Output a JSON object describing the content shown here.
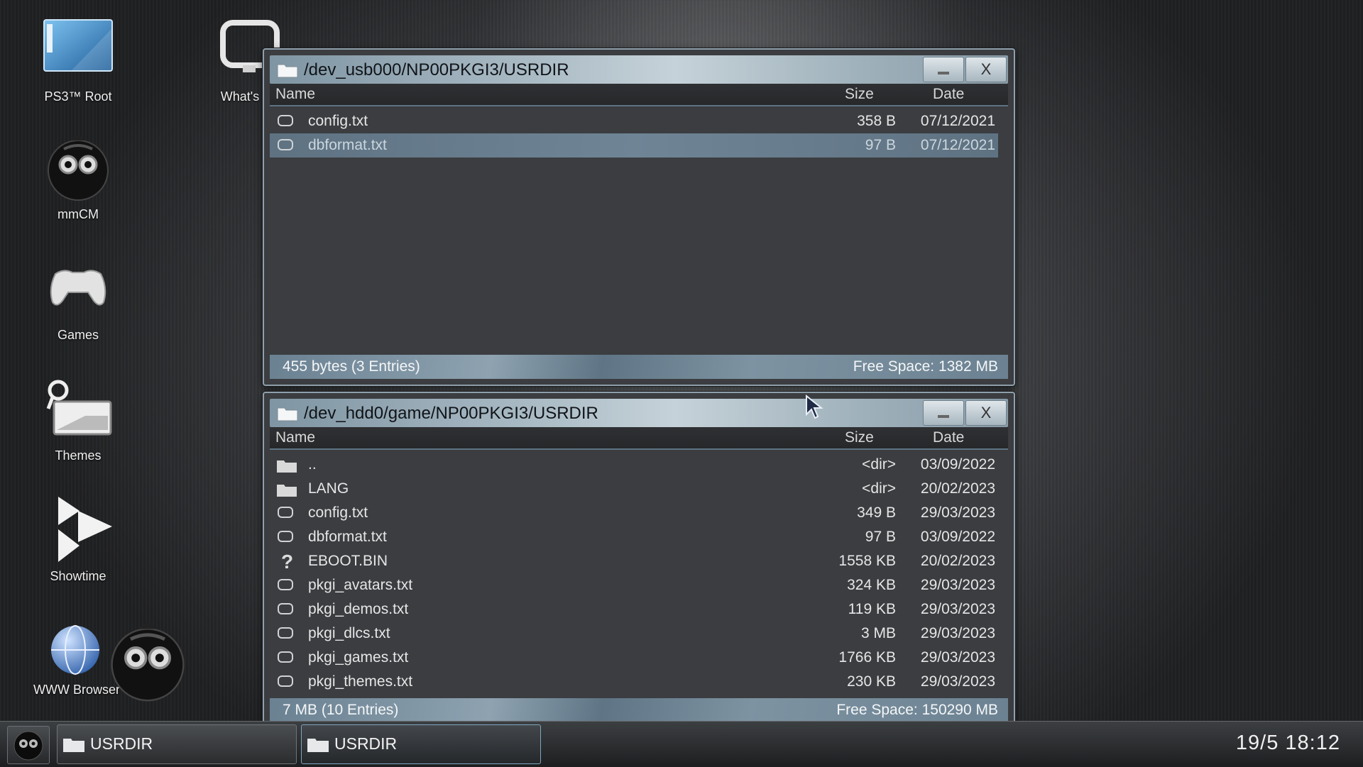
{
  "desktop": {
    "icons": [
      {
        "label": "PS3™ Root",
        "icon": "ps3-root-icon"
      },
      {
        "label": "What's Ne",
        "icon": "whats-new-icon"
      },
      {
        "label": "mmCM",
        "icon": "mmcm-icon"
      },
      {
        "label": "Games",
        "icon": "gamepad-icon"
      },
      {
        "label": "Themes",
        "icon": "themes-icon"
      },
      {
        "label": "Showtime",
        "icon": "showtime-icon"
      },
      {
        "label": "WWW Browser",
        "icon": "globe-icon"
      }
    ]
  },
  "window_top": {
    "title": "/dev_usb000/NP00PKGI3/USRDIR",
    "minimize_label": "",
    "close_label": "X",
    "columns": {
      "name": "Name",
      "size": "Size",
      "date": "Date"
    },
    "rows": [
      {
        "icon": "file-icon",
        "name": "config.txt",
        "size": "358 B",
        "date": "07/12/2021",
        "selected": false
      },
      {
        "icon": "file-icon",
        "name": "dbformat.txt",
        "size": "97 B",
        "date": "07/12/2021",
        "selected": true
      }
    ],
    "status_left": "455 bytes (3 Entries)",
    "status_right": "Free Space: 1382 MB"
  },
  "window_bottom": {
    "title": "/dev_hdd0/game/NP00PKGI3/USRDIR",
    "minimize_label": "",
    "close_label": "X",
    "columns": {
      "name": "Name",
      "size": "Size",
      "date": "Date"
    },
    "rows": [
      {
        "icon": "folder-icon",
        "name": "..",
        "size": "<dir>",
        "date": "03/09/2022"
      },
      {
        "icon": "folder-icon",
        "name": "LANG",
        "size": "<dir>",
        "date": "20/02/2023"
      },
      {
        "icon": "file-icon",
        "name": "config.txt",
        "size": "349 B",
        "date": "29/03/2023"
      },
      {
        "icon": "file-icon",
        "name": "dbformat.txt",
        "size": "97 B",
        "date": "03/09/2022"
      },
      {
        "icon": "unknown-file-icon",
        "name": "EBOOT.BIN",
        "size": "1558 KB",
        "date": "20/02/2023"
      },
      {
        "icon": "file-icon",
        "name": "pkgi_avatars.txt",
        "size": "324 KB",
        "date": "29/03/2023"
      },
      {
        "icon": "file-icon",
        "name": "pkgi_demos.txt",
        "size": "119 KB",
        "date": "29/03/2023"
      },
      {
        "icon": "file-icon",
        "name": "pkgi_dlcs.txt",
        "size": "3 MB",
        "date": "29/03/2023"
      },
      {
        "icon": "file-icon",
        "name": "pkgi_games.txt",
        "size": "1766 KB",
        "date": "29/03/2023"
      },
      {
        "icon": "file-icon",
        "name": "pkgi_themes.txt",
        "size": "230 KB",
        "date": "29/03/2023"
      }
    ],
    "status_left": "7 MB (10 Entries)",
    "status_right": "Free Space: 150290 MB"
  },
  "taskbar": {
    "tasks": [
      {
        "label": "USRDIR",
        "active": false
      },
      {
        "label": "USRDIR",
        "active": true
      }
    ],
    "clock": "19/5 18:12"
  },
  "colors": {
    "accent": "#7fa5bf",
    "titlebar": "#a9bac4",
    "selection": "#6f8596"
  }
}
